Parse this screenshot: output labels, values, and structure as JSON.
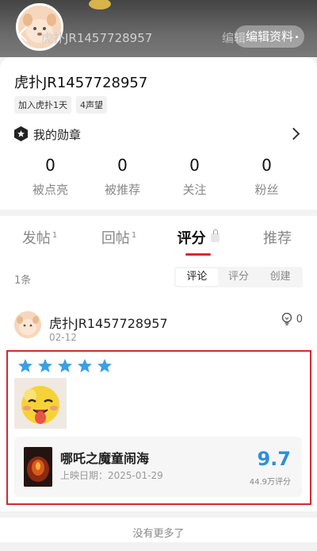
{
  "header": {
    "title_name": "虎扑JR1457728957",
    "edit_ghost": "编辑",
    "edit_button": "编辑资料"
  },
  "profile": {
    "username": "虎扑JR1457728957",
    "tags": [
      "加入虎扑1天",
      "4声望"
    ],
    "badges_label": "我的勋章",
    "stats": [
      {
        "value": "0",
        "label": "被点亮"
      },
      {
        "value": "0",
        "label": "被推荐"
      },
      {
        "value": "0",
        "label": "关注"
      },
      {
        "value": "0",
        "label": "粉丝"
      }
    ]
  },
  "tabs": [
    {
      "label": "发帖",
      "sup": "1"
    },
    {
      "label": "回帖",
      "sup": "1"
    },
    {
      "label": "评分",
      "sup": ""
    },
    {
      "label": "推荐",
      "sup": ""
    }
  ],
  "list": {
    "count": "1条",
    "filters": [
      "评论",
      "评分",
      "创建"
    ]
  },
  "comment": {
    "username": "虎扑JR1457728957",
    "date": "02-12",
    "likes": "0",
    "stars": 5,
    "movie": {
      "title": "哪吒之魔童闹海",
      "release": "上映日期：2025-01-29",
      "score": "9.7",
      "votes": "44.9万评分"
    }
  },
  "footer": {
    "text": "没有更多了"
  },
  "colors": {
    "accent_red": "#e0262d",
    "score_blue": "#2d8fd9",
    "star_blue": "#3aa0e6"
  }
}
